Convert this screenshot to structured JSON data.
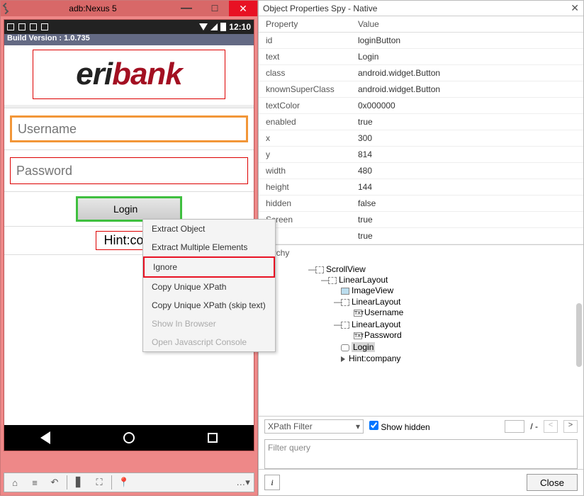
{
  "emulator": {
    "window_title": "adb:Nexus 5",
    "clock": "12:10",
    "build_version": "Build Version : 1.0.735",
    "logo": {
      "part1": "eri",
      "part2": "bank"
    },
    "username_placeholder": "Username",
    "password_placeholder": "Password",
    "login_label": "Login",
    "hint_label": "Hint:com"
  },
  "context_menu": {
    "items": [
      {
        "label": "Extract Object",
        "disabled": false
      },
      {
        "label": "Extract Multiple Elements",
        "disabled": false
      },
      {
        "label": "Ignore",
        "disabled": false,
        "highlight": true
      },
      {
        "label": "Copy Unique XPath",
        "disabled": false
      },
      {
        "label": "Copy Unique XPath (skip text)",
        "disabled": false
      },
      {
        "label": "Show In Browser",
        "disabled": true
      },
      {
        "label": "Open Javascript Console",
        "disabled": true
      }
    ]
  },
  "inspector": {
    "title": "Object Properties Spy - Native",
    "columns": {
      "prop": "Property",
      "val": "Value"
    },
    "properties": [
      {
        "name": "id",
        "value": "loginButton"
      },
      {
        "name": "text",
        "value": "Login"
      },
      {
        "name": "class",
        "value": "android.widget.Button"
      },
      {
        "name": "knownSuperClass",
        "value": "android.widget.Button"
      },
      {
        "name": "textColor",
        "value": "0x000000"
      },
      {
        "name": "enabled",
        "value": "true"
      },
      {
        "name": "x",
        "value": "300"
      },
      {
        "name": "y",
        "value": "814"
      },
      {
        "name": "width",
        "value": "480"
      },
      {
        "name": "height",
        "value": "144"
      },
      {
        "name": "hidden",
        "value": "false"
      },
      {
        "name": "Screen",
        "value": "true"
      },
      {
        "name": "",
        "value": "true"
      }
    ],
    "hierarchy_label": "rarchy",
    "tree": {
      "root": "ScrollView",
      "l1": "LinearLayout",
      "l1_img": "ImageView",
      "l1_lin1": "LinearLayout",
      "l1_lin1_txt": "Username",
      "l1_lin2": "LinearLayout",
      "l1_lin2_txt": "Password",
      "l1_login": "Login",
      "l1_hint": "Hint:company"
    },
    "filter": {
      "combo": "XPath Filter",
      "show_hidden": "Show hidden",
      "sep": "/ -",
      "query_placeholder": "Filter query"
    },
    "close_button": "Close"
  }
}
